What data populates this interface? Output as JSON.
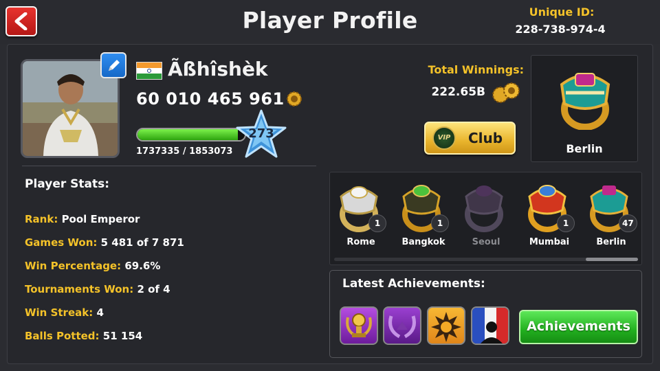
{
  "header": {
    "title": "Player Profile",
    "uid_label": "Unique ID:",
    "uid_value": "228-738-974-4"
  },
  "player": {
    "name": "Ãßhîshèk",
    "country_flag": "india-flag",
    "coins": "60 010 465 961",
    "level": "273",
    "xp_text": "1737335 / 1853073",
    "xp_progress": 0.9375
  },
  "winnings": {
    "label": "Total Winnings:",
    "value": "222.65B"
  },
  "club": {
    "label": "Club",
    "badge_text": "VIP"
  },
  "featured_ring": {
    "label": "Berlin"
  },
  "stats": {
    "title": "Player Stats:",
    "items": [
      {
        "key": "Rank:",
        "value": "Pool Emperor"
      },
      {
        "key": "Games Won:",
        "value": "5 481 of 7 871"
      },
      {
        "key": "Win Percentage:",
        "value": "69.6%"
      },
      {
        "key": "Tournaments Won:",
        "value": "2 of 4"
      },
      {
        "key": "Win Streak:",
        "value": "4"
      },
      {
        "key": "Balls Potted:",
        "value": "51 154"
      }
    ]
  },
  "rings": [
    {
      "name": "Rome",
      "count": "1",
      "owned": true
    },
    {
      "name": "Bangkok",
      "count": "1",
      "owned": true
    },
    {
      "name": "Seoul",
      "count": "",
      "owned": false
    },
    {
      "name": "Mumbai",
      "count": "1",
      "owned": true
    },
    {
      "name": "Berlin",
      "count": "47",
      "owned": true
    }
  ],
  "achievements": {
    "title": "Latest Achievements:",
    "button_label": "Achievements",
    "badges": [
      "trophy-badge-icon",
      "laurel-badge-icon",
      "sun-badge-icon",
      "france-badge-icon"
    ]
  },
  "colors": {
    "gold_label": "#f4c229",
    "background": "#2b2c31",
    "panel": "#26272c",
    "xp_green": "#4fd227",
    "achievements_green": "#22b01f",
    "back_red": "#d42522"
  }
}
